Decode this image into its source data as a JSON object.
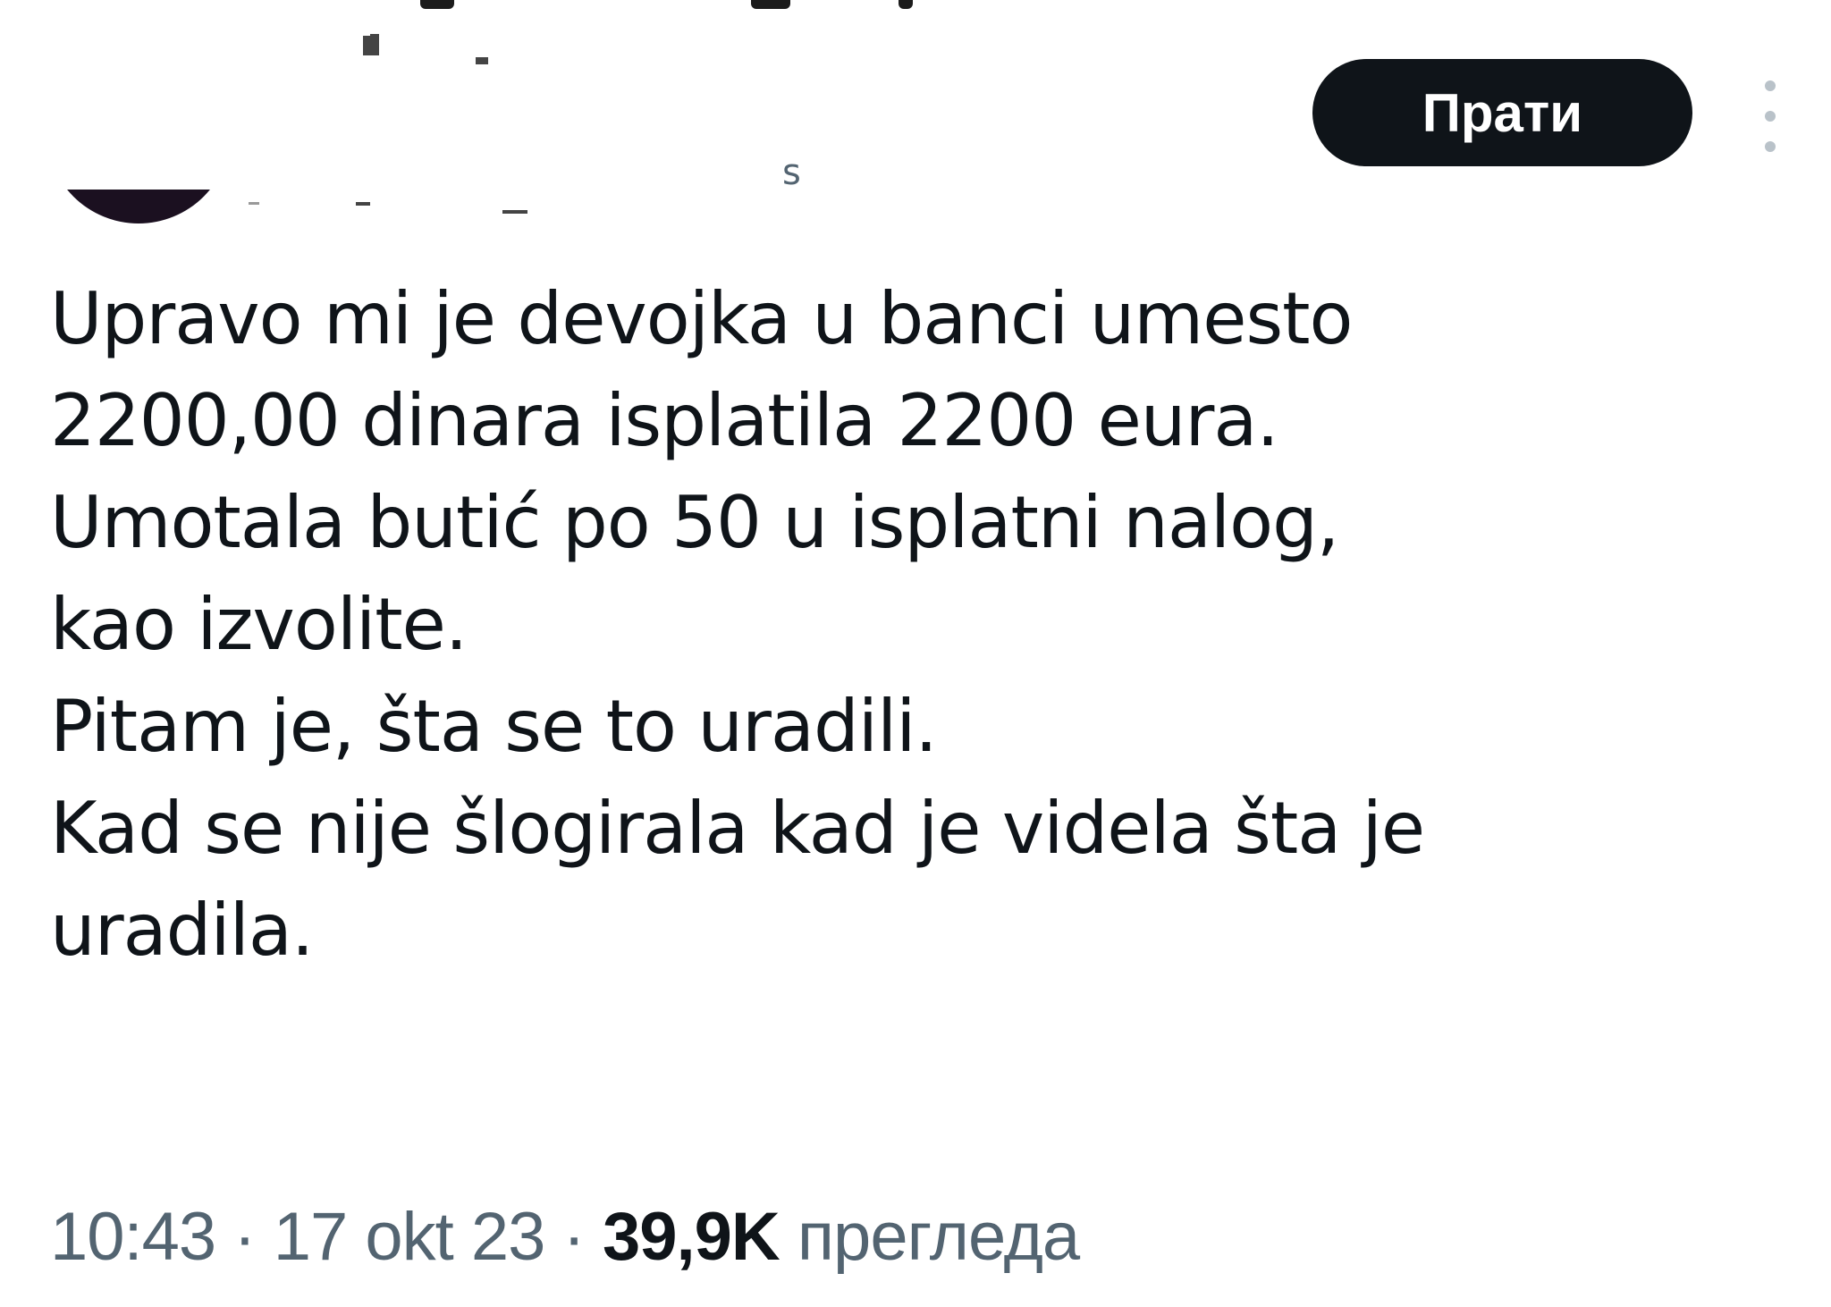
{
  "header": {
    "handle_fragment": "s",
    "follow_label": "Прати"
  },
  "tweet": {
    "lines": [
      "Upravo mi je devojka u banci umesto",
      "2200,00 dinara isplatila 2200 eura.",
      "Umotala butić po 50 u isplatni nalog,",
      "kao izvolite.",
      "Pitam je, šta se to uradili.",
      "Kad se nije šlogirala kad je videla šta je",
      "uradila."
    ]
  },
  "meta": {
    "time": "10:43",
    "separator": " · ",
    "date": "17 okt 23",
    "views_count": "39,9K",
    "views_label": "прегледа"
  },
  "icons": {
    "more": "more-vertical-icon",
    "avatar": "avatar"
  }
}
